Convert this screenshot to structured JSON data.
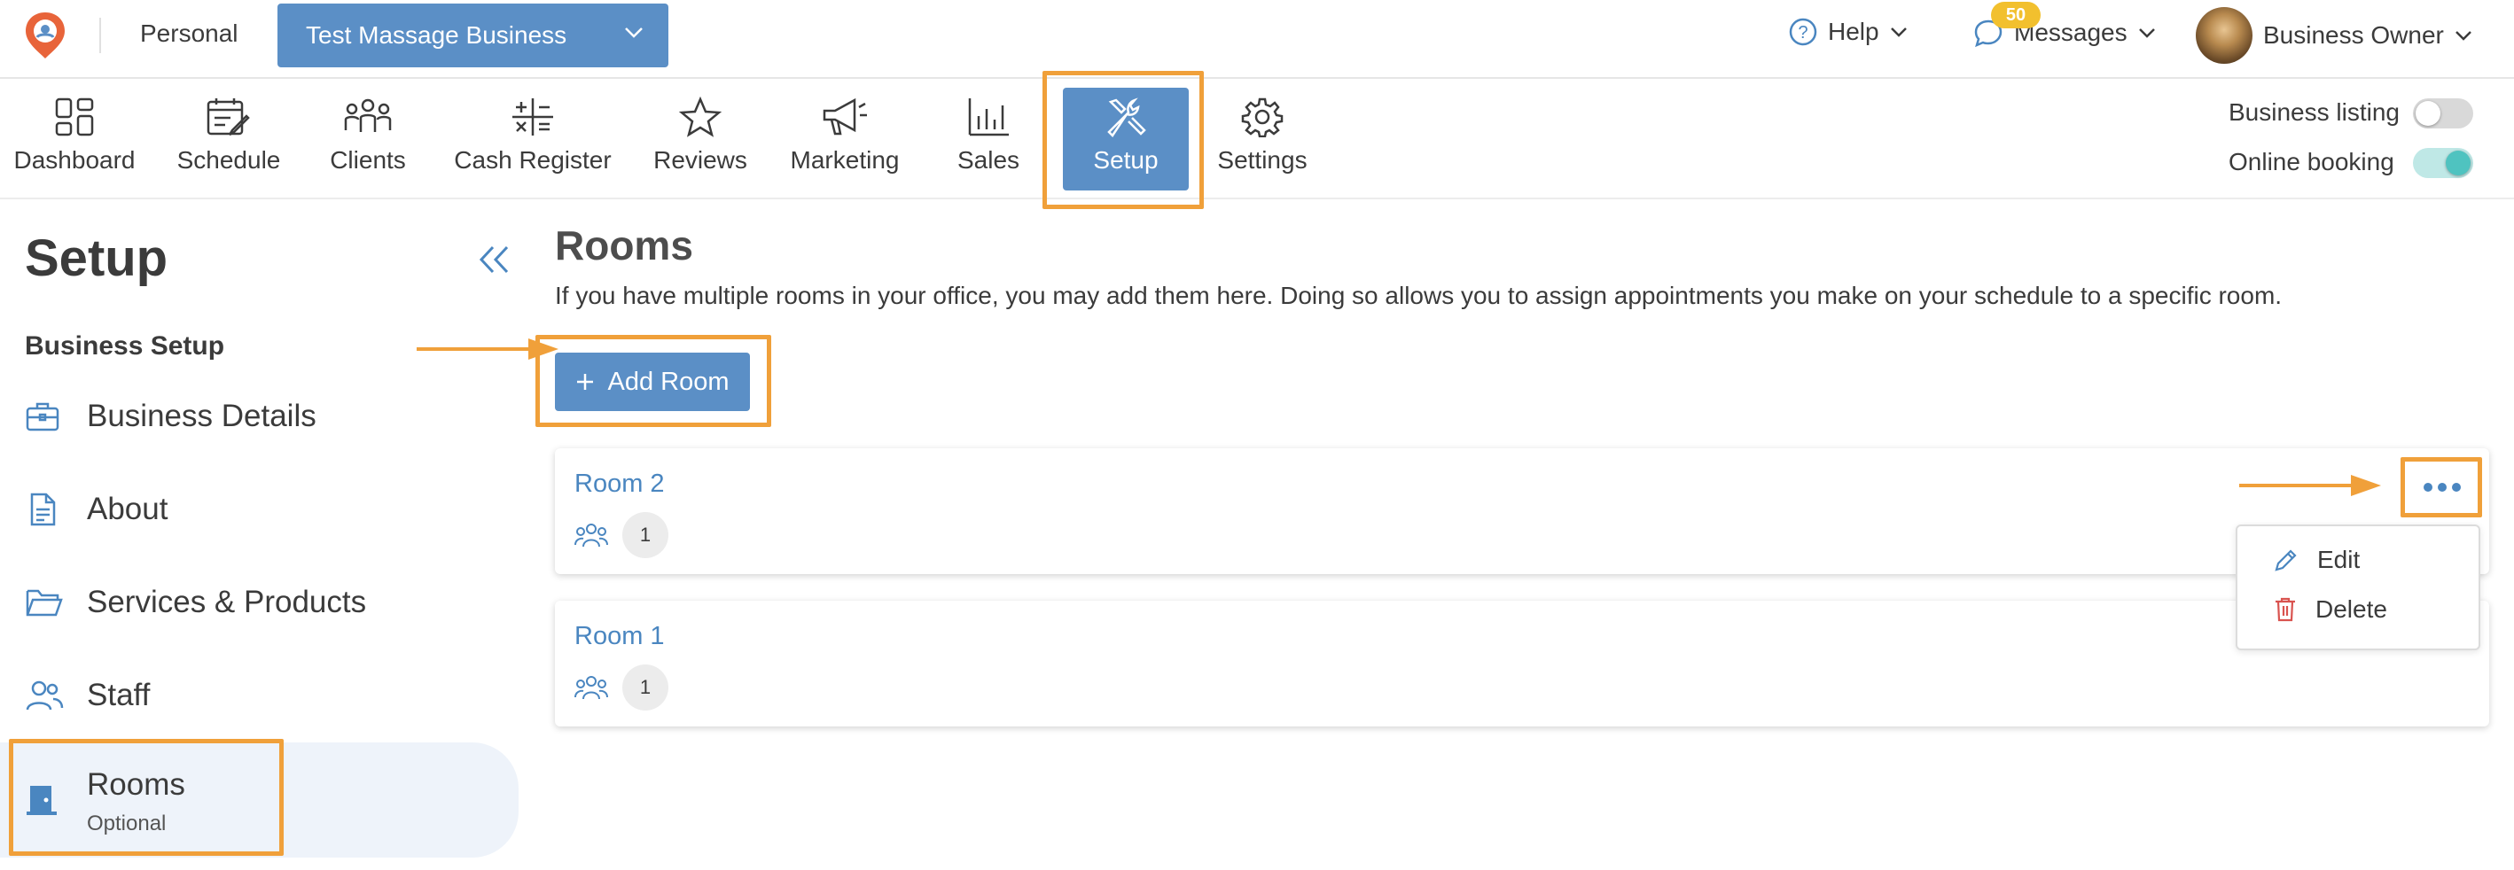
{
  "topbar": {
    "personal_label": "Personal",
    "business_selector": "Test Massage Business",
    "help_label": "Help",
    "messages_label": "Messages",
    "messages_count": "50",
    "user_label": "Business Owner"
  },
  "nav": {
    "items": [
      {
        "label": "Dashboard",
        "icon": "dashboard-icon"
      },
      {
        "label": "Schedule",
        "icon": "calendar-icon"
      },
      {
        "label": "Clients",
        "icon": "clients-icon"
      },
      {
        "label": "Cash Register",
        "icon": "calculator-icon"
      },
      {
        "label": "Reviews",
        "icon": "star-icon"
      },
      {
        "label": "Marketing",
        "icon": "megaphone-icon"
      },
      {
        "label": "Sales",
        "icon": "bar-chart-icon"
      },
      {
        "label": "Setup",
        "icon": "tools-icon"
      },
      {
        "label": "Settings",
        "icon": "gear-icon"
      }
    ],
    "active": "Setup",
    "toggles": [
      {
        "label": "Business listing",
        "on": false
      },
      {
        "label": "Online booking",
        "on": true
      }
    ]
  },
  "sidebar": {
    "title": "Setup",
    "section": "Business Setup",
    "items": [
      {
        "label": "Business Details",
        "icon": "briefcase-icon"
      },
      {
        "label": "About",
        "icon": "document-icon"
      },
      {
        "label": "Services & Products",
        "icon": "folder-icon"
      },
      {
        "label": "Staff",
        "icon": "staff-icon"
      },
      {
        "label": "Rooms",
        "icon": "door-icon",
        "sub": "Optional"
      }
    ]
  },
  "main": {
    "title": "Rooms",
    "description": "If you have multiple rooms in your office, you may add them here. Doing so allows you to assign appointments you make on your schedule to a specific room.",
    "add_button": "Add Room",
    "rooms": [
      {
        "name": "Room 2",
        "capacity": "1"
      },
      {
        "name": "Room 1",
        "capacity": "1"
      }
    ],
    "menu": {
      "edit": "Edit",
      "delete": "Delete"
    }
  },
  "colors": {
    "primary": "#5b8fc6",
    "link": "#4a86c0",
    "highlight": "#f0a03a",
    "toggle_on": "#4fc3c0",
    "danger": "#d9534f",
    "badge": "#f2c02e"
  }
}
